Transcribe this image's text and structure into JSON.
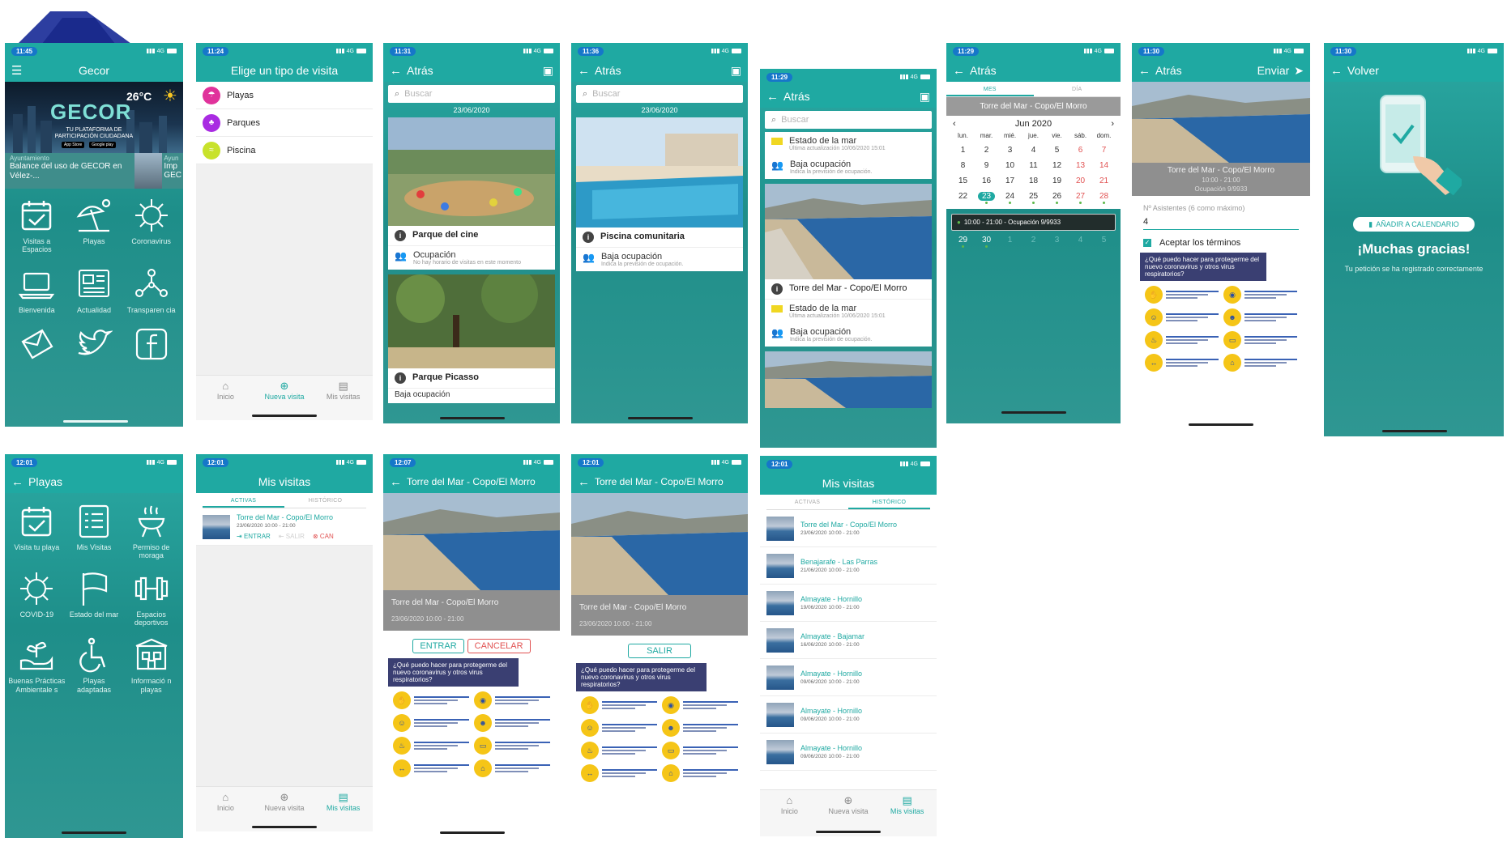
{
  "colors": {
    "teal": "#1fa9a2",
    "teal_dark": "#1e8e89",
    "blue_pill": "#1677c9",
    "green": "#5eb84a",
    "red": "#e15252",
    "yellow": "#f0d722"
  },
  "s1": {
    "time": "11:45",
    "signal": "4G",
    "title": "Gecor",
    "temperature": "26°C",
    "banner_logo": "GECOR",
    "banner_tagline_1": "TU PLATAFORMA DE",
    "banner_tagline_2": "PARTICIPACIÓN CIUDADANA",
    "banner_appstore": "App Store",
    "banner_googleplay": "Google play",
    "news_1_source": "Ayuntamiento",
    "news_1_title": "Balance del uso de GECOR en Vélez-...",
    "news_2_source": "Ayun",
    "news_2_title_1": "Imp",
    "news_2_title_2": "GEC",
    "tiles": [
      {
        "label": "Visitas a Espacios",
        "icon": "calendar-check-icon"
      },
      {
        "label": "Playas",
        "icon": "beach-umbrella-icon"
      },
      {
        "label": "Coronavirus",
        "icon": "virus-icon"
      },
      {
        "label": "Bienvenida",
        "icon": "laptop-icon"
      },
      {
        "label": "Actualidad",
        "icon": "news-icon"
      },
      {
        "label": "Transparen cia",
        "icon": "network-people-icon"
      },
      {
        "label": "",
        "icon": "envelope-icon"
      },
      {
        "label": "",
        "icon": "twitter-icon"
      },
      {
        "label": "",
        "icon": "facebook-icon"
      }
    ]
  },
  "s2": {
    "time": "11:24",
    "signal": "4G",
    "title": "Elige un tipo de visita",
    "items": [
      {
        "label": "Playas",
        "color": "#e0329b"
      },
      {
        "label": "Parques",
        "color": "#a92be2"
      },
      {
        "label": "Piscina",
        "color": "#c8e22b"
      }
    ]
  },
  "tabs": {
    "home": "Inicio",
    "new_visit": "Nueva visita",
    "my_visits": "Mis visitas"
  },
  "s3": {
    "time": "11:31",
    "signal": "4G",
    "back": "Atrás",
    "search_placeholder": "Buscar",
    "date": "23/06/2020",
    "card_1_title": "Parque del cine",
    "card_1_row_title": "Ocupación",
    "card_1_row_sub": "No hay horario de visitas en este momento",
    "card_2_title": "Parque Picasso",
    "card_2_row_title": "Baja ocupación"
  },
  "s4": {
    "time": "11:36",
    "signal": "4G",
    "back": "Atrás",
    "search_placeholder": "Buscar",
    "date": "23/06/2020",
    "card_title": "Piscina comunitaria",
    "row_title": "Baja ocupación",
    "row_sub": "Indica la previsión de ocupación."
  },
  "s5": {
    "time": "11:29",
    "signal": "4G",
    "back": "Atrás",
    "search_placeholder": "Buscar",
    "state_title": "Estado de la mar",
    "state_sub": "Última actualización 10/06/2020 15:01",
    "occ_title": "Baja ocupación",
    "occ_sub": "Indica la previsión de ocupación.",
    "beach_title": "Torre del Mar - Copo/El Morro"
  },
  "s6": {
    "time": "11:29",
    "signal": "4G",
    "back": "Atrás",
    "tab_month": "MES",
    "tab_day": "DÍA",
    "place": "Torre del Mar - Copo/El Morro",
    "month": "Jun 2020",
    "dow": [
      "lun.",
      "mar.",
      "mié.",
      "jue.",
      "vie.",
      "sáb.",
      "dom."
    ],
    "slot": "10:00 - 21:00 - Ocupación 9/9933"
  },
  "s7": {
    "time": "11:30",
    "signal": "4G",
    "back": "Atrás",
    "send": "Enviar",
    "place": "Torre del Mar - Copo/El Morro",
    "hours": "10:00 - 21:00",
    "occupation": "Ocupación 9/9933",
    "attendees_label": "Nº Asistentes (6 como máximo)",
    "attendees_value": "4",
    "terms": "Aceptar los términos"
  },
  "poster": {
    "head": "¿Qué puedo hacer para protegerme del nuevo coronavirus y otros virus respiratorios?"
  },
  "s8": {
    "time": "11:30",
    "signal": "4G",
    "back": "Volver",
    "calendar_button": "AÑADIR A CALENDARIO",
    "thanks": "¡Muchas gracias!",
    "message": "Tu petición se ha registrado correctamente"
  },
  "s9": {
    "time": "12:01",
    "signal": "4G",
    "back": "Playas",
    "tiles": [
      {
        "label": "Visita tu playa",
        "icon": "calendar-check-icon"
      },
      {
        "label": "Mis Visitas",
        "icon": "checklist-icon"
      },
      {
        "label": "Permiso de moraga",
        "icon": "barbecue-icon"
      },
      {
        "label": "COVID-19",
        "icon": "virus-icon"
      },
      {
        "label": "Estado del mar",
        "icon": "flag-icon"
      },
      {
        "label": "Espacios deportivos",
        "icon": "dumbbell-icon"
      },
      {
        "label": "Buenas Prácticas Ambientale s",
        "icon": "plant-hand-icon"
      },
      {
        "label": "Playas adaptadas",
        "icon": "wheelchair-icon"
      },
      {
        "label": "Informació n playas",
        "icon": "beach-info-icon"
      }
    ]
  },
  "s10": {
    "time": "12:01",
    "signal": "4G",
    "title": "Mis visitas",
    "tab_active": "ACTIVAS",
    "tab_history": "HISTÓRICO",
    "visit_name": "Torre del Mar - Copo/El Morro",
    "visit_date": "23/06/2020 10:00 - 21:00",
    "enter": "ENTRAR",
    "exit": "SALIR",
    "cancel": "CAN"
  },
  "s11": {
    "time": "12:07",
    "signal": "4G",
    "back": "Torre del Mar - Copo/El Morro",
    "place": "Torre del Mar - Copo/El Morro",
    "date": "23/06/2020 10:00 - 21:00",
    "enter": "ENTRAR",
    "cancel": "CANCELAR"
  },
  "s12": {
    "time": "12:01",
    "signal": "4G",
    "back": "Torre del Mar - Copo/El Morro",
    "place": "Torre del Mar - Copo/El Morro",
    "date": "23/06/2020 10:00 - 21:00",
    "exit": "SALIR"
  },
  "s13": {
    "time": "12:01",
    "signal": "4G",
    "title": "Mis visitas",
    "tab_active": "ACTIVAS",
    "tab_history": "HISTÓRICO",
    "visits": [
      {
        "name": "Torre del Mar - Copo/El Morro",
        "date": "23/06/2020 10:00 - 21:00"
      },
      {
        "name": "Benajarafe - Las Parras",
        "date": "21/06/2020 10:00 - 21:00"
      },
      {
        "name": "Almayate - Hornillo",
        "date": "19/06/2020 10:00 - 21:00"
      },
      {
        "name": "Almayate - Bajamar",
        "date": "16/06/2020 10:00 - 21:00"
      },
      {
        "name": "Almayate - Hornillo",
        "date": "09/06/2020 10:00 - 21:00"
      },
      {
        "name": "Almayate - Hornillo",
        "date": "09/06/2020 10:00 - 21:00"
      },
      {
        "name": "Almayate - Hornillo",
        "date": "09/06/2020 10:00 - 21:00"
      }
    ]
  }
}
